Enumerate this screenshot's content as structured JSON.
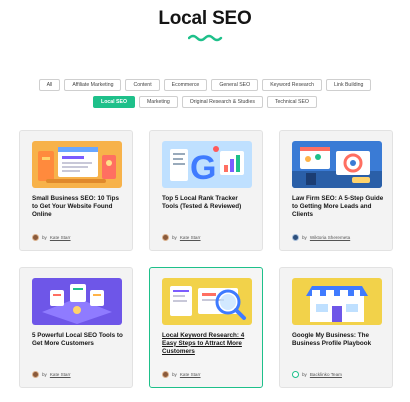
{
  "page": {
    "title": "Local SEO"
  },
  "filters": {
    "row1": [
      "All",
      "Affiliate Marketing",
      "Content",
      "Ecommerce",
      "General SEO",
      "Keyword Research",
      "Link Building"
    ],
    "row2": [
      "Local SEO",
      "Marketing",
      "Original Research & Studies",
      "Technical SEO"
    ],
    "active": "Local SEO",
    "accent_color": "#1ec08a"
  },
  "cards": [
    {
      "title": "Small Business SEO: 10 Tips to Get Your Website Found Online",
      "by": "by",
      "author": "Kate Starr"
    },
    {
      "title": "Top 5 Local Rank Tracker Tools (Tested & Reviewed)",
      "by": "by",
      "author": "Kate Starr"
    },
    {
      "title": "Law Firm SEO: A 5-Step Guide to Getting More Leads and Clients",
      "by": "by",
      "author": "Wiktoria Sheremeta"
    },
    {
      "title": "5 Powerful Local SEO Tools to Get More Customers",
      "by": "by",
      "author": "Kate Starr"
    },
    {
      "title": "Local Keyword Research: 4 Easy Steps to Attract More Customers",
      "by": "by",
      "author": "Kate Starr"
    },
    {
      "title": "Google My Business: The Business Profile Playbook",
      "by": "by",
      "author": "Backlinko Team"
    }
  ]
}
